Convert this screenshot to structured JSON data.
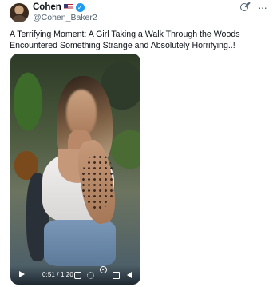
{
  "tweet": {
    "author_name": "Cohen",
    "handle": "@Cohen_Baker2",
    "text": "A Terrifying Moment: A Girl Taking a Walk Through the Woods Encountered Something Strange and Absolutely Horrifying..!",
    "icons": {
      "flag": "us-flag-icon",
      "verified": "verified-badge-icon",
      "grok": "grok-icon",
      "more": "more-options-icon"
    },
    "verified_symbol": "✓",
    "more_symbol": "···"
  },
  "video": {
    "time_display": "0:51 / 1:20",
    "accent_color": "#1d9bf0",
    "controls": [
      "play-icon",
      "captions-icon",
      "settings-icon",
      "gif-icon",
      "fullscreen-icon",
      "volume-icon"
    ]
  }
}
